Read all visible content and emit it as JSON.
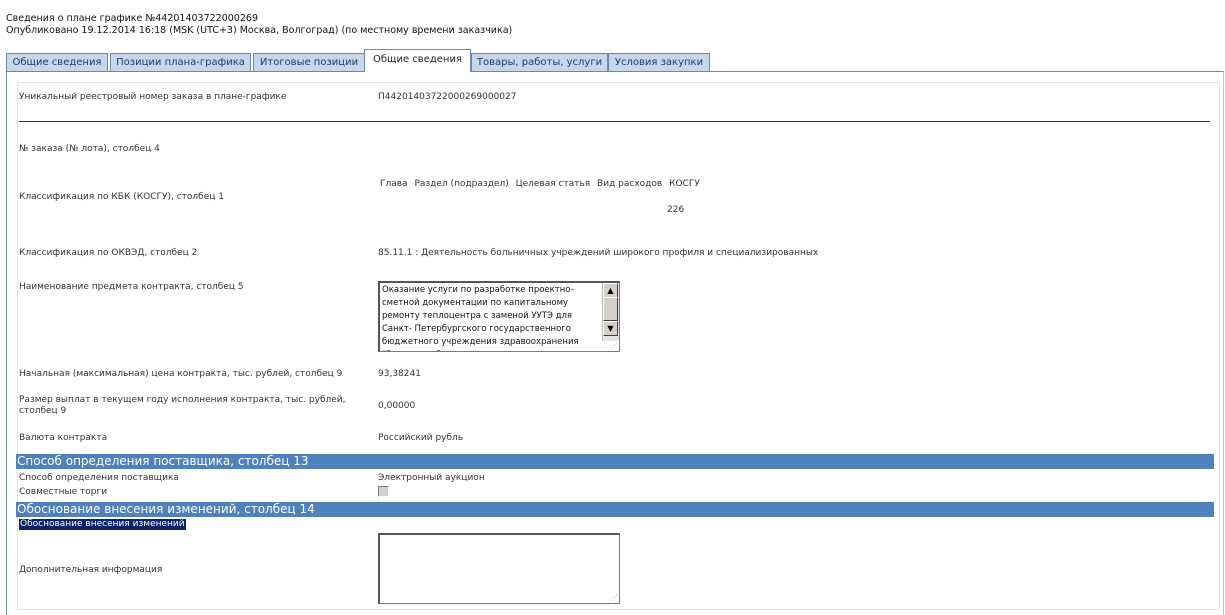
{
  "header": {
    "title": "Сведения о плане графике №44201403722000269",
    "published": "Опубликовано 19.12.2014 16:18 (MSK (UTC+3) Москва, Волгоград) (по местному времени заказчика)"
  },
  "tabs": [
    {
      "label": "Общие сведения",
      "active": false
    },
    {
      "label": "Позиции плана-графика",
      "active": false
    },
    {
      "label": "Итоговые позиции",
      "active": false
    },
    {
      "label": "Общие сведения",
      "active": true
    },
    {
      "label": "Товары, работы, услуги",
      "active": false
    },
    {
      "label": "Условия закупки",
      "active": false
    }
  ],
  "fields": {
    "unique_number": {
      "label": "Уникальный реестровый номер заказа в плане-графике",
      "value": "П44201403722000269000027"
    },
    "lot_number": {
      "label": "№ заказа (№ лота), столбец 4"
    },
    "kbk": {
      "label": "Классификация по КБК (КОСГУ), столбец 1",
      "columns": [
        "Глава",
        "Раздел (подраздел)",
        "Целевая статья",
        "Вид расходов",
        "КОСГУ"
      ],
      "kosgu_value": "226"
    },
    "okved": {
      "label": "Классификация по ОКВЭД, столбец 2",
      "value": "85.11.1 : Деятельность больничных учреждений широкого профиля и специализированных"
    },
    "subject": {
      "label": "Наименование предмета контракта, столбец 5",
      "value": "Оказание услуги по разработке проектно-сметной документации по капитальному ремонту теплоцентра с заменой УУТЭ для Санкт- Петербургского государственного бюджетного учреждения здравоохранения \"Городская больница"
    },
    "max_price": {
      "label": "Начальная (максимальная) цена контракта, тыс. рублей, столбец 9",
      "value": "93,38241"
    },
    "payments": {
      "label": "Размер выплат в текущем году исполнения контракта, тыс. рублей, столбец 9",
      "value": "0,00000"
    },
    "currency": {
      "label": "Валюта контракта",
      "value": "Российский рубль"
    }
  },
  "section_supplier": {
    "title": "Способ определения поставщика, столбец 13",
    "method_label": "Способ определения поставщика",
    "method_value": "Электронный аукцион",
    "joint_label": "Совместные торги",
    "joint_checked": false
  },
  "section_changes": {
    "title": "Обоснование внесения изменений, столбец 14",
    "reason_label": "Обоснование внесения изменений",
    "extra_label": "Дополнительная информация",
    "extra_value": ""
  },
  "colors": {
    "tab_bg": "#c7d6e8",
    "tab_border": "#6a89b0",
    "section_bg": "#4f81bd",
    "highlight": "#0a246a"
  }
}
